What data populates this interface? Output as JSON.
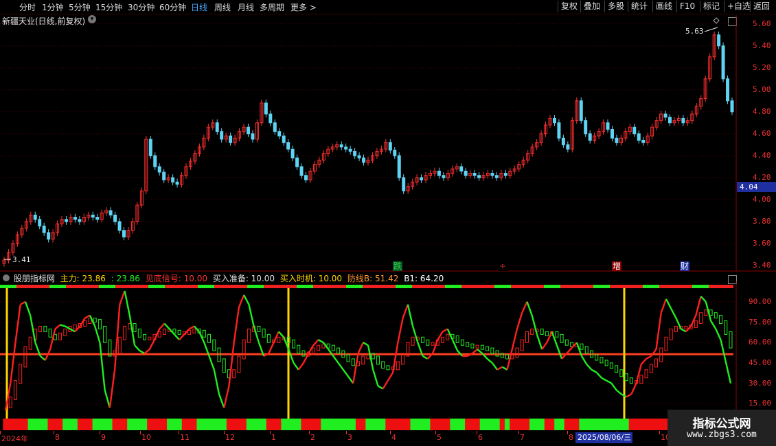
{
  "toolbar": {
    "periods": [
      "分时",
      "1分钟",
      "5分钟",
      "15分钟",
      "30分钟",
      "60分钟",
      "日线",
      "周线",
      "月线",
      "多周期",
      "更多 >"
    ],
    "active": "日线",
    "buttons": [
      "复权",
      "叠加",
      "多股",
      "统计",
      "画线",
      "F10",
      "标记",
      "+自选",
      "返回"
    ]
  },
  "stock": {
    "title": "新疆天业(日线,前复权)"
  },
  "price_axis": [
    "5.60",
    "5.40",
    "5.20",
    "5.00",
    "4.80",
    "4.60",
    "4.40",
    "4.20",
    "4.00",
    "3.80",
    "3.60",
    "3.40"
  ],
  "current_price": "4.04",
  "high_label": "5.63",
  "low_label": "3.41",
  "events": [
    {
      "text": "跌",
      "color": "#2ecc40",
      "bg": "#0a5c2a"
    },
    {
      "text": "÷",
      "color": "#e33",
      "bg": "#000"
    },
    {
      "text": "增",
      "color": "#fff",
      "bg": "#8b0000"
    },
    {
      "text": "财",
      "color": "#fff",
      "bg": "#1f2fa0"
    }
  ],
  "indicator": {
    "name": "股朋指标网",
    "items": [
      {
        "label": "主力: 23.86",
        "color": "#ffd700"
      },
      {
        "label": ": 23.86",
        "color": "#22ee22"
      },
      {
        "label": "见底信号: 10.00",
        "color": "#ff3030"
      },
      {
        "label": "买入准备: 10.00",
        "color": "#e0e0e0"
      },
      {
        "label": "买入时机: 10.00",
        "color": "#ffd700"
      },
      {
        "label": "防线B: 51.42",
        "color": "#ff9a30"
      },
      {
        "label": "B1: 64.20",
        "color": "#ffffff"
      }
    ],
    "axis": [
      "90.00",
      "75.00",
      "60.00",
      "45.00",
      "30.00",
      "15.00"
    ]
  },
  "dates": [
    "2024年",
    "8",
    "9",
    "10",
    "11",
    "12",
    "1",
    "2",
    "3",
    "4",
    "5",
    "6",
    "7",
    "8",
    "9",
    "10"
  ],
  "cursor_date": "2025/08/06/三",
  "logo": {
    "top": "指标公式网",
    "bottom": "www.zbgs3.com"
  },
  "chart_data": {
    "type": "line",
    "price_close": [
      3.45,
      3.52,
      3.6,
      3.68,
      3.74,
      3.8,
      3.86,
      3.82,
      3.76,
      3.7,
      3.64,
      3.7,
      3.78,
      3.82,
      3.8,
      3.84,
      3.82,
      3.8,
      3.84,
      3.86,
      3.84,
      3.82,
      3.88,
      3.9,
      3.86,
      3.8,
      3.72,
      3.66,
      3.72,
      3.8,
      3.95,
      4.08,
      4.55,
      4.4,
      4.3,
      4.25,
      4.18,
      4.2,
      4.16,
      4.14,
      4.22,
      4.3,
      4.35,
      4.42,
      4.48,
      4.56,
      4.66,
      4.7,
      4.62,
      4.55,
      4.58,
      4.52,
      4.56,
      4.62,
      4.66,
      4.6,
      4.55,
      4.7,
      4.88,
      4.78,
      4.7,
      4.62,
      4.58,
      4.52,
      4.46,
      4.38,
      4.3,
      4.22,
      4.18,
      4.26,
      4.32,
      4.36,
      4.42,
      4.46,
      4.48,
      4.5,
      4.48,
      4.46,
      4.44,
      4.4,
      4.38,
      4.34,
      4.36,
      4.4,
      4.44,
      4.46,
      4.52,
      4.45,
      4.4,
      4.2,
      4.08,
      4.12,
      4.16,
      4.2,
      4.18,
      4.22,
      4.24,
      4.26,
      4.22,
      4.2,
      4.24,
      4.28,
      4.3,
      4.26,
      4.22,
      4.24,
      4.22,
      4.2,
      4.22,
      4.24,
      4.22,
      4.2,
      4.24,
      4.22,
      4.26,
      4.28,
      4.32,
      4.36,
      4.42,
      4.48,
      4.52,
      4.6,
      4.68,
      4.74,
      4.7,
      4.56,
      4.5,
      4.46,
      4.72,
      4.9,
      4.72,
      4.6,
      4.54,
      4.58,
      4.62,
      4.7,
      4.64,
      4.56,
      4.52,
      4.56,
      4.62,
      4.66,
      4.6,
      4.54,
      4.52,
      4.58,
      4.66,
      4.72,
      4.78,
      4.75,
      4.7,
      4.72,
      4.74,
      4.7,
      4.72,
      4.78,
      4.85,
      4.92,
      5.1,
      5.3,
      5.5,
      5.4,
      5.1,
      4.9,
      4.8
    ],
    "price_ylim": [
      3.35,
      5.68
    ],
    "indicator_main": [
      10,
      30,
      60,
      88,
      90,
      80,
      60,
      50,
      47,
      55,
      70,
      73,
      72,
      70,
      68,
      72,
      78,
      80,
      72,
      60,
      25,
      12,
      40,
      88,
      98,
      80,
      58,
      54,
      52,
      55,
      62,
      70,
      74,
      70,
      66,
      62,
      66,
      70,
      72,
      68,
      60,
      50,
      40,
      22,
      12,
      28,
      60,
      86,
      95,
      88,
      72,
      60,
      50,
      52,
      60,
      68,
      64,
      55,
      45,
      40,
      45,
      52,
      58,
      62,
      60,
      55,
      50,
      45,
      40,
      35,
      30,
      52,
      60,
      58,
      40,
      28,
      26,
      32,
      38,
      60,
      78,
      88,
      72,
      60,
      50,
      48,
      52,
      62,
      68,
      70,
      62,
      54,
      50,
      50,
      52,
      55,
      52,
      48,
      45,
      40,
      42,
      40,
      55,
      70,
      82,
      90,
      80,
      66,
      55,
      60,
      68,
      58,
      48,
      52,
      56,
      60,
      50,
      44,
      40,
      38,
      34,
      32,
      30,
      25,
      22,
      20,
      22,
      30,
      44,
      48,
      50,
      55,
      82,
      92,
      85,
      78,
      70,
      68,
      72,
      80,
      94,
      90,
      76,
      70,
      62,
      46,
      30
    ],
    "indicator_signal": [
      12,
      18,
      30,
      42,
      55,
      62,
      68,
      70,
      68,
      64,
      62,
      65,
      68,
      70,
      71,
      72,
      74,
      76,
      75,
      70,
      60,
      50,
      52,
      62,
      70,
      72,
      68,
      64,
      62,
      62,
      64,
      66,
      68,
      68,
      67,
      66,
      66,
      67,
      68,
      67,
      64,
      60,
      54,
      46,
      38,
      34,
      38,
      48,
      60,
      68,
      70,
      68,
      64,
      60,
      60,
      62,
      62,
      60,
      56,
      52,
      50,
      51,
      54,
      56,
      57,
      56,
      54,
      52,
      49,
      46,
      43,
      44,
      48,
      50,
      48,
      44,
      41,
      40,
      40,
      44,
      50,
      58,
      62,
      62,
      60,
      58,
      58,
      60,
      62,
      64,
      63,
      60,
      58,
      57,
      56,
      56,
      55,
      54,
      52,
      50,
      49,
      48,
      49,
      54,
      60,
      66,
      68,
      68,
      66,
      65,
      66,
      64,
      60,
      58,
      57,
      57,
      55,
      52,
      49,
      47,
      45,
      43,
      41,
      38,
      35,
      32,
      30,
      30,
      34,
      38,
      42,
      46,
      54,
      62,
      68,
      70,
      70,
      70,
      71,
      74,
      80,
      82,
      80,
      78,
      74,
      66,
      56
    ]
  }
}
